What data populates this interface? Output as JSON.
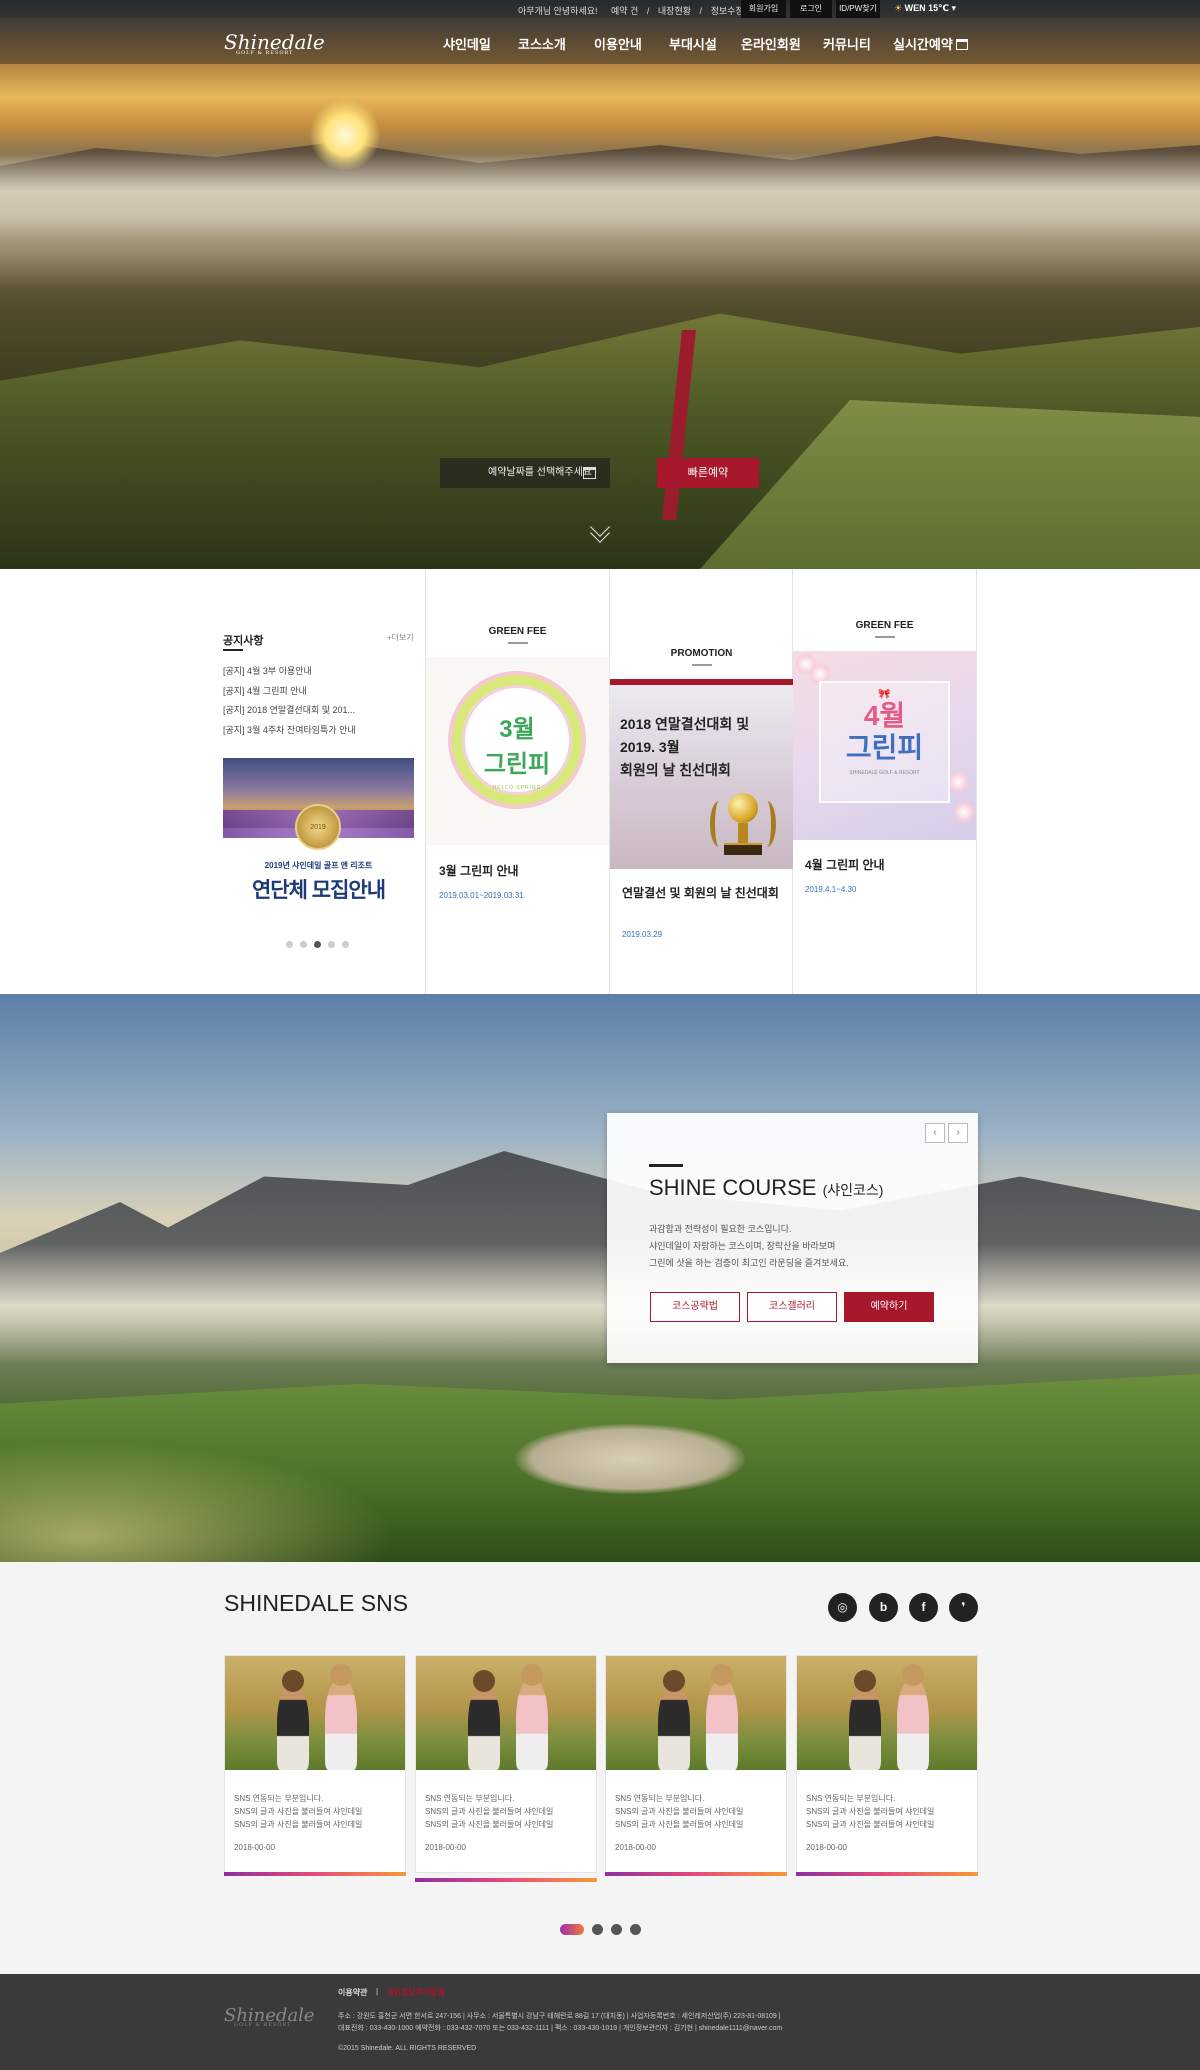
{
  "topbar": {
    "greeting": "아무개님 안녕하세요!",
    "links": [
      "예약 건",
      "/",
      "내장현황",
      "/",
      "정보수정"
    ],
    "buttons": [
      "회원가입",
      "로그인",
      "ID/PW찾기"
    ],
    "weather": "WEN 15℃"
  },
  "logo": {
    "name": "Shinedale",
    "sub": "GOLF & RESORT"
  },
  "menu": [
    "샤인데일",
    "코스소개",
    "이용안내",
    "부대시설",
    "온라인회원",
    "커뮤니티",
    "실시간예약"
  ],
  "hero": {
    "date_placeholder": "예약날짜를 선택해주세요",
    "quick_button": "빠른예약"
  },
  "notice": {
    "title": "공지사항",
    "more": "+더보기",
    "items": [
      "[공지] 4월 3부 이용안내",
      "[공지] 4월 그린피 안내",
      "[공지] 2018 연말결선대회 및 201...",
      "[공지] 3월 4주차 잔여타임특가 안내"
    ],
    "banner_medal": "2019",
    "banner_sub": "2019년 샤인데일 골프 앤 리조트",
    "banner_main": "연단체 모집안내",
    "dots_count": 5,
    "active_dot": 2
  },
  "cards": [
    {
      "category": "GREEN FEE",
      "img_line1": "3월",
      "img_line2": "그린피",
      "img_line3": "HELLO SPRING",
      "title": "3월 그린피 안내",
      "date": "2019.03.01~2019.03.31"
    },
    {
      "category": "PROMOTION",
      "img_lines": [
        "2018 연말결선대회 및",
        "2019. 3월",
        "회원의 날 친선대회"
      ],
      "title": "연말결선 및 회원의 날 친선대회",
      "date": "2019.03.29"
    },
    {
      "category": "GREEN FEE",
      "img_line1": "4월",
      "img_line2": "그린피",
      "img_line3": "SHINEDALE GOLF & RESORT",
      "title": "4월 그린피 안내",
      "date": "2019.4.1~4.30"
    }
  ],
  "course": {
    "prev": "‹",
    "next": "›",
    "title": "SHINE COURSE",
    "title_sub": "(샤인코스)",
    "desc": [
      "과감함과 전략성이 필요한 코스입니다.",
      "샤인데일이 자랑하는 코스이며, 장락산을 바라보며",
      "그린에 샷을 하는 검증이 최고인 라운딩을 즐겨보세요."
    ],
    "buttons": [
      "코스공략법",
      "코스갤러리",
      "예약하기"
    ]
  },
  "sns": {
    "title": "SHINEDALE SNS",
    "icons": [
      "instagram-icon",
      "naver-blog-icon",
      "facebook-icon",
      "kakao-story-icon"
    ],
    "icon_glyphs": [
      "◎",
      "b",
      "f",
      "❜"
    ],
    "posts": [
      {
        "lines": [
          "SNS 연동되는 부분입니다.",
          "SNS의 글과 사진을 불러들여 샤인데일",
          "SNS의 글과 사진을 불러들여 샤인데일"
        ],
        "date": "2018-00-00"
      },
      {
        "lines": [
          "SNS 연동되는 부분입니다.",
          "SNS의 글과 사진을 불러들여 샤인데일",
          "SNS의 글과 사진을 불러들여 샤인데일"
        ],
        "date": "2018-00-00"
      },
      {
        "lines": [
          "SNS 연동되는 부분입니다.",
          "SNS의 글과 사진을 불러들여 샤인데일",
          "SNS의 글과 사진을 불러들여 샤인데일"
        ],
        "date": "2018-00-00"
      },
      {
        "lines": [
          "SNS 연동되는 부분입니다.",
          "SNS의 글과 사진을 불러들여 샤인데일",
          "SNS의 글과 사진을 불러들여 샤인데일"
        ],
        "date": "2018-00-00"
      }
    ],
    "dots_count": 4,
    "active_dot": 0
  },
  "footer": {
    "links": [
      "이용약관",
      "개인정보처리방침"
    ],
    "address": "주소 : 강원도 홍천군 서면 한서로 247-156  |  사무소 : 서울특별시 강남구 테헤란로 88길 17 (대치동)  |  사업자등록번호 : 세인레저산업(주) 223-81-08109  |",
    "contact": "대표전화 : 033-430-1000 예약전화 : 033-432-7070 또는 033-432-1111  |  팩스 : 033-430-1019  |  개인정보관리자 : 김기현  |  shinedale1111@naver.com",
    "copyright": "©2015 Shinedale. ALL RIGHTS RESERVED"
  },
  "colors": {
    "accent": "#a8182c",
    "footer_bg": "#3a3a3a"
  }
}
